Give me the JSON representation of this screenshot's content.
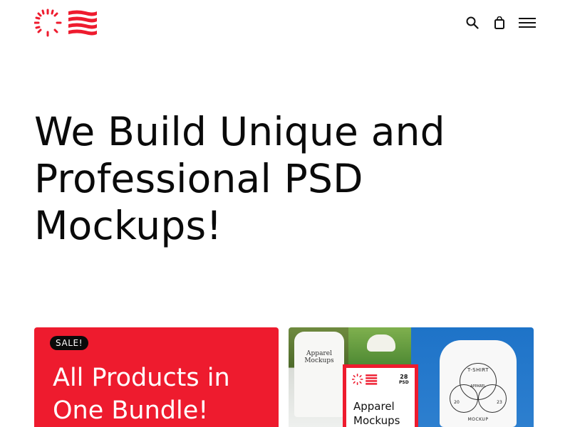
{
  "header": {
    "logo_name": "red-stripes-logo",
    "icons": {
      "search": "search-icon",
      "cart": "shopping-bag-icon",
      "menu": "hamburger-menu-icon"
    }
  },
  "hero": {
    "lines": [
      "We Build Unique and",
      "Professional PSD",
      "Mockups!"
    ]
  },
  "products": [
    {
      "badge": "SALE!",
      "title_lines": [
        "All Products in",
        "One Bundle!"
      ]
    },
    {
      "tshirt_back_text_lines": [
        "Apparel",
        "Mockups"
      ],
      "poster": {
        "count": "28",
        "format": "PSD",
        "title_lines": [
          "Apparel",
          "Mockups"
        ]
      },
      "tshirt_front": {
        "top": "T-SHIRT",
        "middle": "APPAREL",
        "year_left": "20",
        "year_right": "23",
        "bottom": "MOCKUP"
      }
    }
  ],
  "colors": {
    "brand_red": "#ee1b2e",
    "text": "#0a0a0a",
    "background": "#ffffff"
  }
}
